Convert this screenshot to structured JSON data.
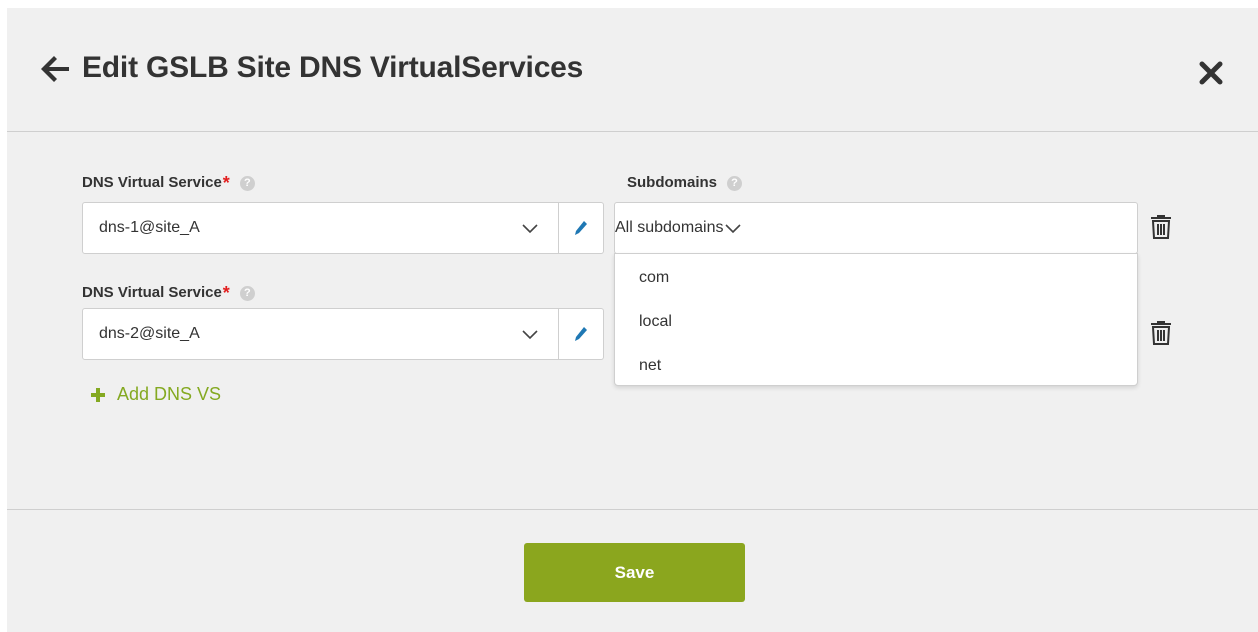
{
  "dialog": {
    "title": "Edit GSLB Site DNS VirtualServices",
    "back_icon": "arrow-left-icon",
    "close_icon": "close-icon"
  },
  "rows": [
    {
      "label": "DNS Virtual Service",
      "required_mark": "*",
      "help": "?",
      "value": "dns-1@site_A"
    },
    {
      "label": "DNS Virtual Service",
      "required_mark": "*",
      "help": "?",
      "value": "dns-2@site_A"
    }
  ],
  "subdomains": {
    "label": "Subdomains",
    "help": "?",
    "placeholder": "All subdomains",
    "options": [
      "com",
      "local",
      "net"
    ]
  },
  "add_link": "Add DNS VS",
  "save_label": "Save",
  "colors": {
    "accent_green": "#8ba61e",
    "link_green": "#84a921",
    "required_red": "#e21d1d",
    "edit_pencil_blue": "#1f78b4",
    "background": "#f0f0f0"
  }
}
